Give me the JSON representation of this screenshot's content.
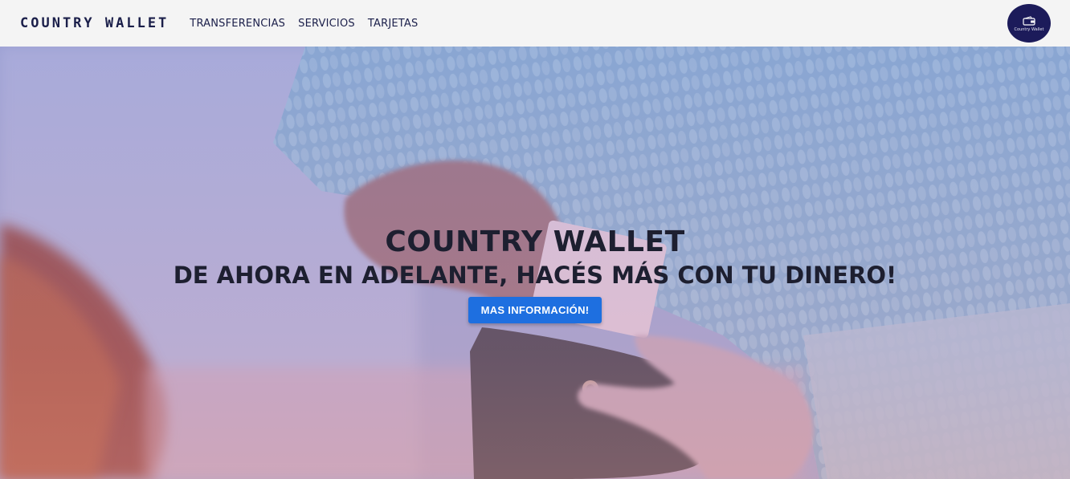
{
  "navbar": {
    "brand": "COUNTRY WALLET",
    "links": [
      "TRANSFERENCIAS",
      "SERVICIOS",
      "TARJETAS"
    ],
    "logo_text": "Country Wallet"
  },
  "hero": {
    "title": "COUNTRY WALLET",
    "subtitle": "DE AHORA EN ADELANTE, HACÉS MÁS CON TU DINERO!",
    "button_label": "MAS INFORMACIÓN!"
  },
  "colors": {
    "navbar_bg": "#f4f4f4",
    "brand_text": "#1b1f4a",
    "logo_bg": "#1c1b5a",
    "button_bg": "#1e6fe0"
  }
}
